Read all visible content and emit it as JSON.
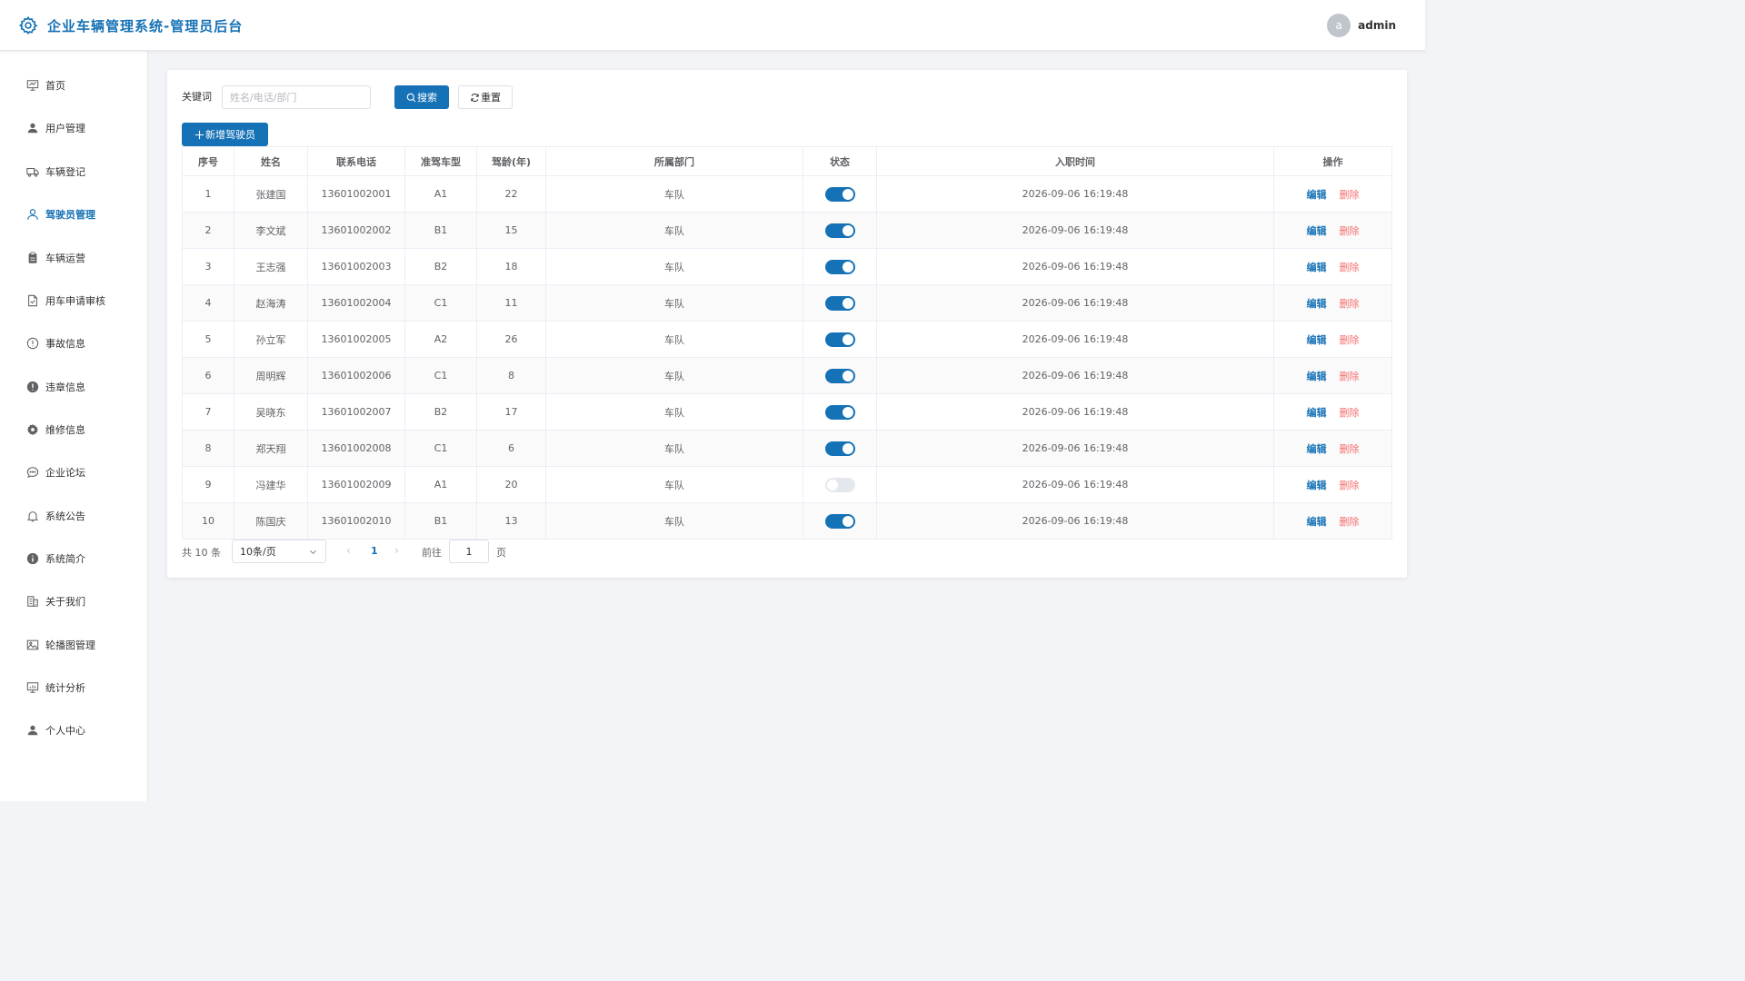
{
  "header": {
    "title": "企业车辆管理系统-管理员后台",
    "avatar_letter": "a",
    "username": "admin"
  },
  "sidebar": {
    "items": [
      {
        "label": "首页",
        "icon": "presentation-icon"
      },
      {
        "label": "用户管理",
        "icon": "user-icon"
      },
      {
        "label": "车辆登记",
        "icon": "truck-icon"
      },
      {
        "label": "驾驶员管理",
        "icon": "user-outline-icon",
        "active": true
      },
      {
        "label": "车辆运营",
        "icon": "clipboard-icon"
      },
      {
        "label": "用车申请审核",
        "icon": "document-icon"
      },
      {
        "label": "事故信息",
        "icon": "warning-circle-icon"
      },
      {
        "label": "违章信息",
        "icon": "warning-filled-icon"
      },
      {
        "label": "维修信息",
        "icon": "gear-icon"
      },
      {
        "label": "企业论坛",
        "icon": "chat-icon"
      },
      {
        "label": "系统公告",
        "icon": "bell-icon"
      },
      {
        "label": "系统简介",
        "icon": "info-icon"
      },
      {
        "label": "关于我们",
        "icon": "building-icon"
      },
      {
        "label": "轮播图管理",
        "icon": "picture-icon"
      },
      {
        "label": "统计分析",
        "icon": "chart-icon"
      },
      {
        "label": "个人中心",
        "icon": "user-icon"
      }
    ]
  },
  "search": {
    "label": "关键词",
    "placeholder": "姓名/电话/部门",
    "value": "",
    "search_label": "搜索",
    "reset_label": "重置"
  },
  "toolbar": {
    "add_label": "新增驾驶员"
  },
  "table": {
    "columns": [
      "序号",
      "姓名",
      "联系电话",
      "准驾车型",
      "驾龄(年)",
      "所属部门",
      "状态",
      "入职时间",
      "操作"
    ],
    "edit_label": "编辑",
    "delete_label": "删除",
    "rows": [
      {
        "no": "1",
        "name": "张建国",
        "phone": "13601002001",
        "license": "A1",
        "years": "22",
        "dept": "车队",
        "status": true,
        "joined": "2026-09-06 16:19:48"
      },
      {
        "no": "2",
        "name": "李文斌",
        "phone": "13601002002",
        "license": "B1",
        "years": "15",
        "dept": "车队",
        "status": true,
        "joined": "2026-09-06 16:19:48"
      },
      {
        "no": "3",
        "name": "王志强",
        "phone": "13601002003",
        "license": "B2",
        "years": "18",
        "dept": "车队",
        "status": true,
        "joined": "2026-09-06 16:19:48"
      },
      {
        "no": "4",
        "name": "赵海涛",
        "phone": "13601002004",
        "license": "C1",
        "years": "11",
        "dept": "车队",
        "status": true,
        "joined": "2026-09-06 16:19:48"
      },
      {
        "no": "5",
        "name": "孙立军",
        "phone": "13601002005",
        "license": "A2",
        "years": "26",
        "dept": "车队",
        "status": true,
        "joined": "2026-09-06 16:19:48"
      },
      {
        "no": "6",
        "name": "周明辉",
        "phone": "13601002006",
        "license": "C1",
        "years": "8",
        "dept": "车队",
        "status": true,
        "joined": "2026-09-06 16:19:48"
      },
      {
        "no": "7",
        "name": "吴晓东",
        "phone": "13601002007",
        "license": "B2",
        "years": "17",
        "dept": "车队",
        "status": true,
        "joined": "2026-09-06 16:19:48"
      },
      {
        "no": "8",
        "name": "郑天翔",
        "phone": "13601002008",
        "license": "C1",
        "years": "6",
        "dept": "车队",
        "status": true,
        "joined": "2026-09-06 16:19:48"
      },
      {
        "no": "9",
        "name": "冯建华",
        "phone": "13601002009",
        "license": "A1",
        "years": "20",
        "dept": "车队",
        "status": false,
        "joined": "2026-09-06 16:19:48"
      },
      {
        "no": "10",
        "name": "陈国庆",
        "phone": "13601002010",
        "license": "B1",
        "years": "13",
        "dept": "车队",
        "status": true,
        "joined": "2026-09-06 16:19:48"
      }
    ]
  },
  "pagination": {
    "total_text": "共 10 条",
    "page_size": "10条/页",
    "current_page": "1",
    "goto_label": "前往",
    "goto_value": "1",
    "page_suffix": "页"
  },
  "colors": {
    "accent": "#1672b6",
    "danger": "#f56c6c"
  }
}
